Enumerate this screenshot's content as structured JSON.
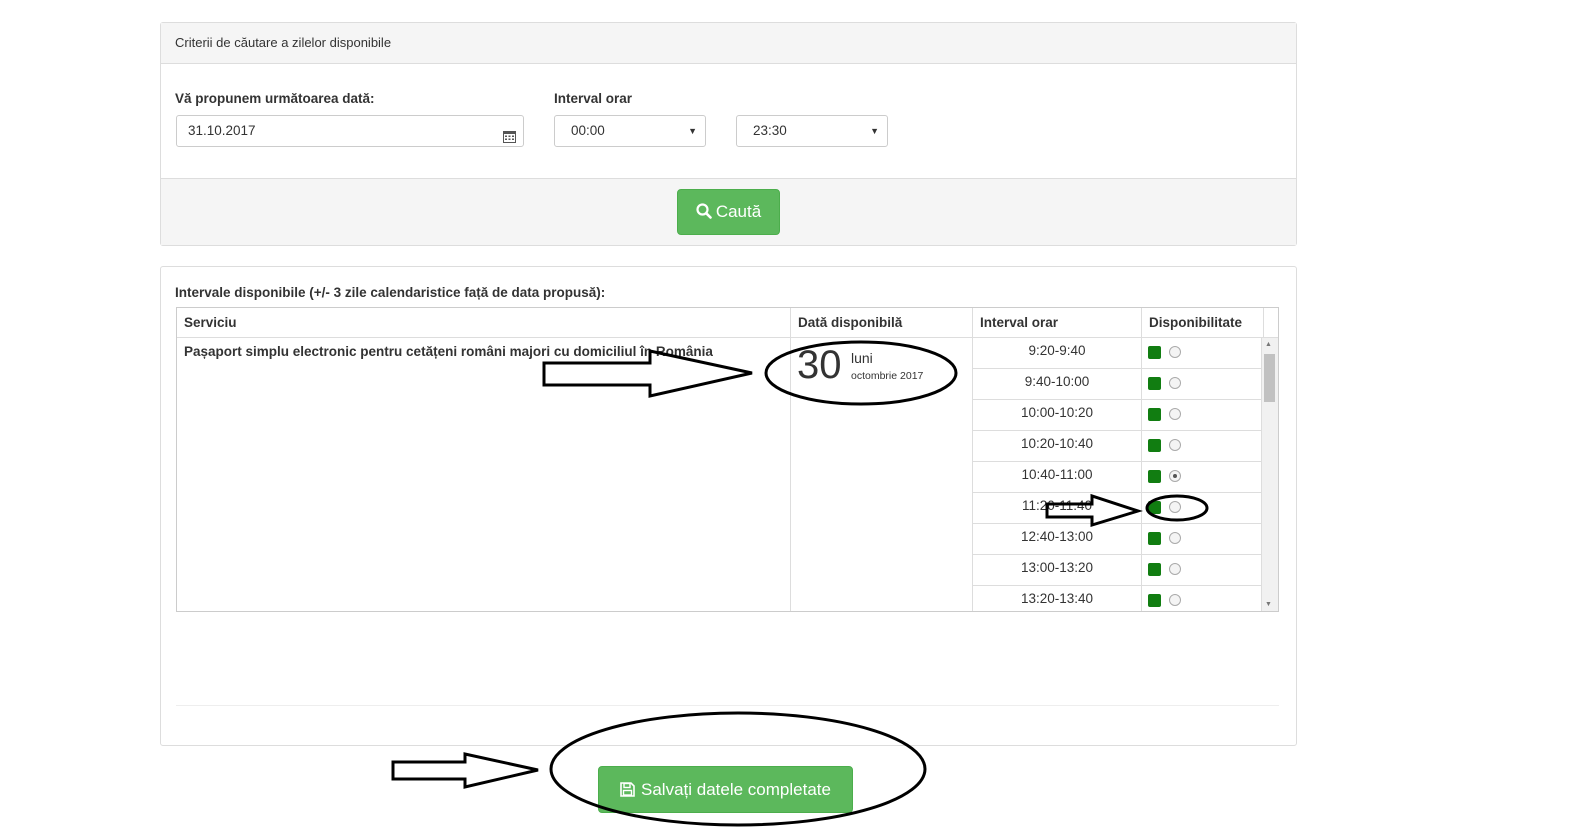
{
  "search": {
    "header": "Criterii de căutare a zilelor disponibile",
    "date_label": "Vă propunem următoarea dată:",
    "date_value": "31.10.2017",
    "interval_label": "Interval orar",
    "from_value": "00:00",
    "to_value": "23:30",
    "search_button": "Caută"
  },
  "results": {
    "title": "Intervale disponibile (+/- 3 zile calendaristice față de data propusă):",
    "columns": [
      "Serviciu",
      "Dată disponibilă",
      "Interval orar",
      "Disponibilitate"
    ],
    "service": "Pașaport simplu electronic pentru cetățeni români majori cu domiciliul în România",
    "date_day": "30",
    "date_weekday": "luni",
    "date_month": "octombrie 2017",
    "slots": [
      "9:20-9:40",
      "9:40-10:00",
      "10:00-10:20",
      "10:20-10:40",
      "10:40-11:00",
      "11:20-11:40",
      "12:40-13:00",
      "13:00-13:20",
      "13:20-13:40"
    ],
    "selected_slot_index": 4
  },
  "save_button": "Salvați datele completate",
  "colors": {
    "button_green": "#5cb85c",
    "available_green": "#117d11"
  },
  "icons": [
    "calendar-icon",
    "search-icon",
    "save-icon"
  ]
}
